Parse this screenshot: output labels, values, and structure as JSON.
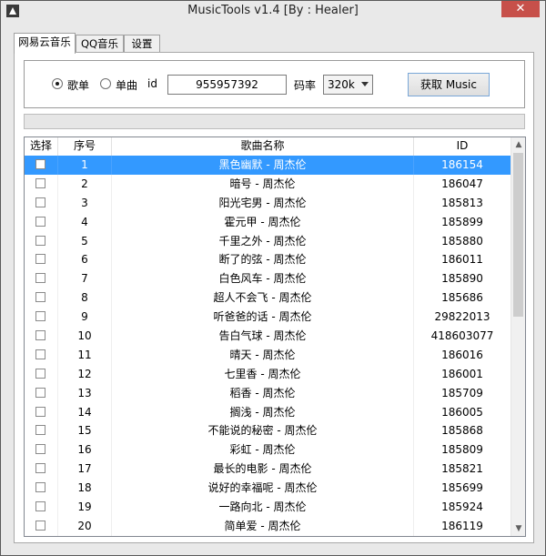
{
  "window": {
    "title": "MusicTools v1.4 [By : Healer]",
    "close_glyph": "✕"
  },
  "tabs": [
    {
      "label": "网易云音乐",
      "active": true
    },
    {
      "label": "QQ音乐",
      "active": false
    },
    {
      "label": "设置",
      "active": false
    }
  ],
  "form": {
    "radio_playlist_label": "歌单",
    "radio_single_label": "单曲",
    "selected_mode": "歌单",
    "id_label": "id",
    "id_value": "955957392",
    "bitrate_label": "码率",
    "bitrate_value": "320k",
    "fetch_button_label": "获取 Music"
  },
  "progress": {
    "value": 0
  },
  "table": {
    "headers": {
      "select": "选择",
      "index": "序号",
      "name": "歌曲名称",
      "id": "ID"
    },
    "rows": [
      {
        "index": "1",
        "name": "黑色幽默 - 周杰伦",
        "id": "186154",
        "selected": true
      },
      {
        "index": "2",
        "name": "暗号 - 周杰伦",
        "id": "186047"
      },
      {
        "index": "3",
        "name": "阳光宅男 - 周杰伦",
        "id": "185813"
      },
      {
        "index": "4",
        "name": "霍元甲 - 周杰伦",
        "id": "185899"
      },
      {
        "index": "5",
        "name": "千里之外 - 周杰伦",
        "id": "185880"
      },
      {
        "index": "6",
        "name": "断了的弦 - 周杰伦",
        "id": "186011"
      },
      {
        "index": "7",
        "name": "白色风车 - 周杰伦",
        "id": "185890"
      },
      {
        "index": "8",
        "name": "超人不会飞 - 周杰伦",
        "id": "185686"
      },
      {
        "index": "9",
        "name": "听爸爸的话 - 周杰伦",
        "id": "29822013"
      },
      {
        "index": "10",
        "name": "告白气球 - 周杰伦",
        "id": "418603077"
      },
      {
        "index": "11",
        "name": "晴天 - 周杰伦",
        "id": "186016"
      },
      {
        "index": "12",
        "name": "七里香 - 周杰伦",
        "id": "186001"
      },
      {
        "index": "13",
        "name": "稻香 - 周杰伦",
        "id": "185709"
      },
      {
        "index": "14",
        "name": "搁浅 - 周杰伦",
        "id": "186005"
      },
      {
        "index": "15",
        "name": "不能说的秘密 - 周杰伦",
        "id": "185868"
      },
      {
        "index": "16",
        "name": "彩虹 - 周杰伦",
        "id": "185809"
      },
      {
        "index": "17",
        "name": "最长的电影 - 周杰伦",
        "id": "185821"
      },
      {
        "index": "18",
        "name": "说好的幸福呢 - 周杰伦",
        "id": "185699"
      },
      {
        "index": "19",
        "name": "一路向北 - 周杰伦",
        "id": "185924"
      },
      {
        "index": "20",
        "name": "简单爱 - 周杰伦",
        "id": "186119"
      }
    ]
  },
  "scrollbar": {
    "up_glyph": "▲",
    "down_glyph": "▼"
  },
  "colors": {
    "selection": "#3399ff",
    "close_button": "#c7504a",
    "progress_fill": "#06b025"
  }
}
